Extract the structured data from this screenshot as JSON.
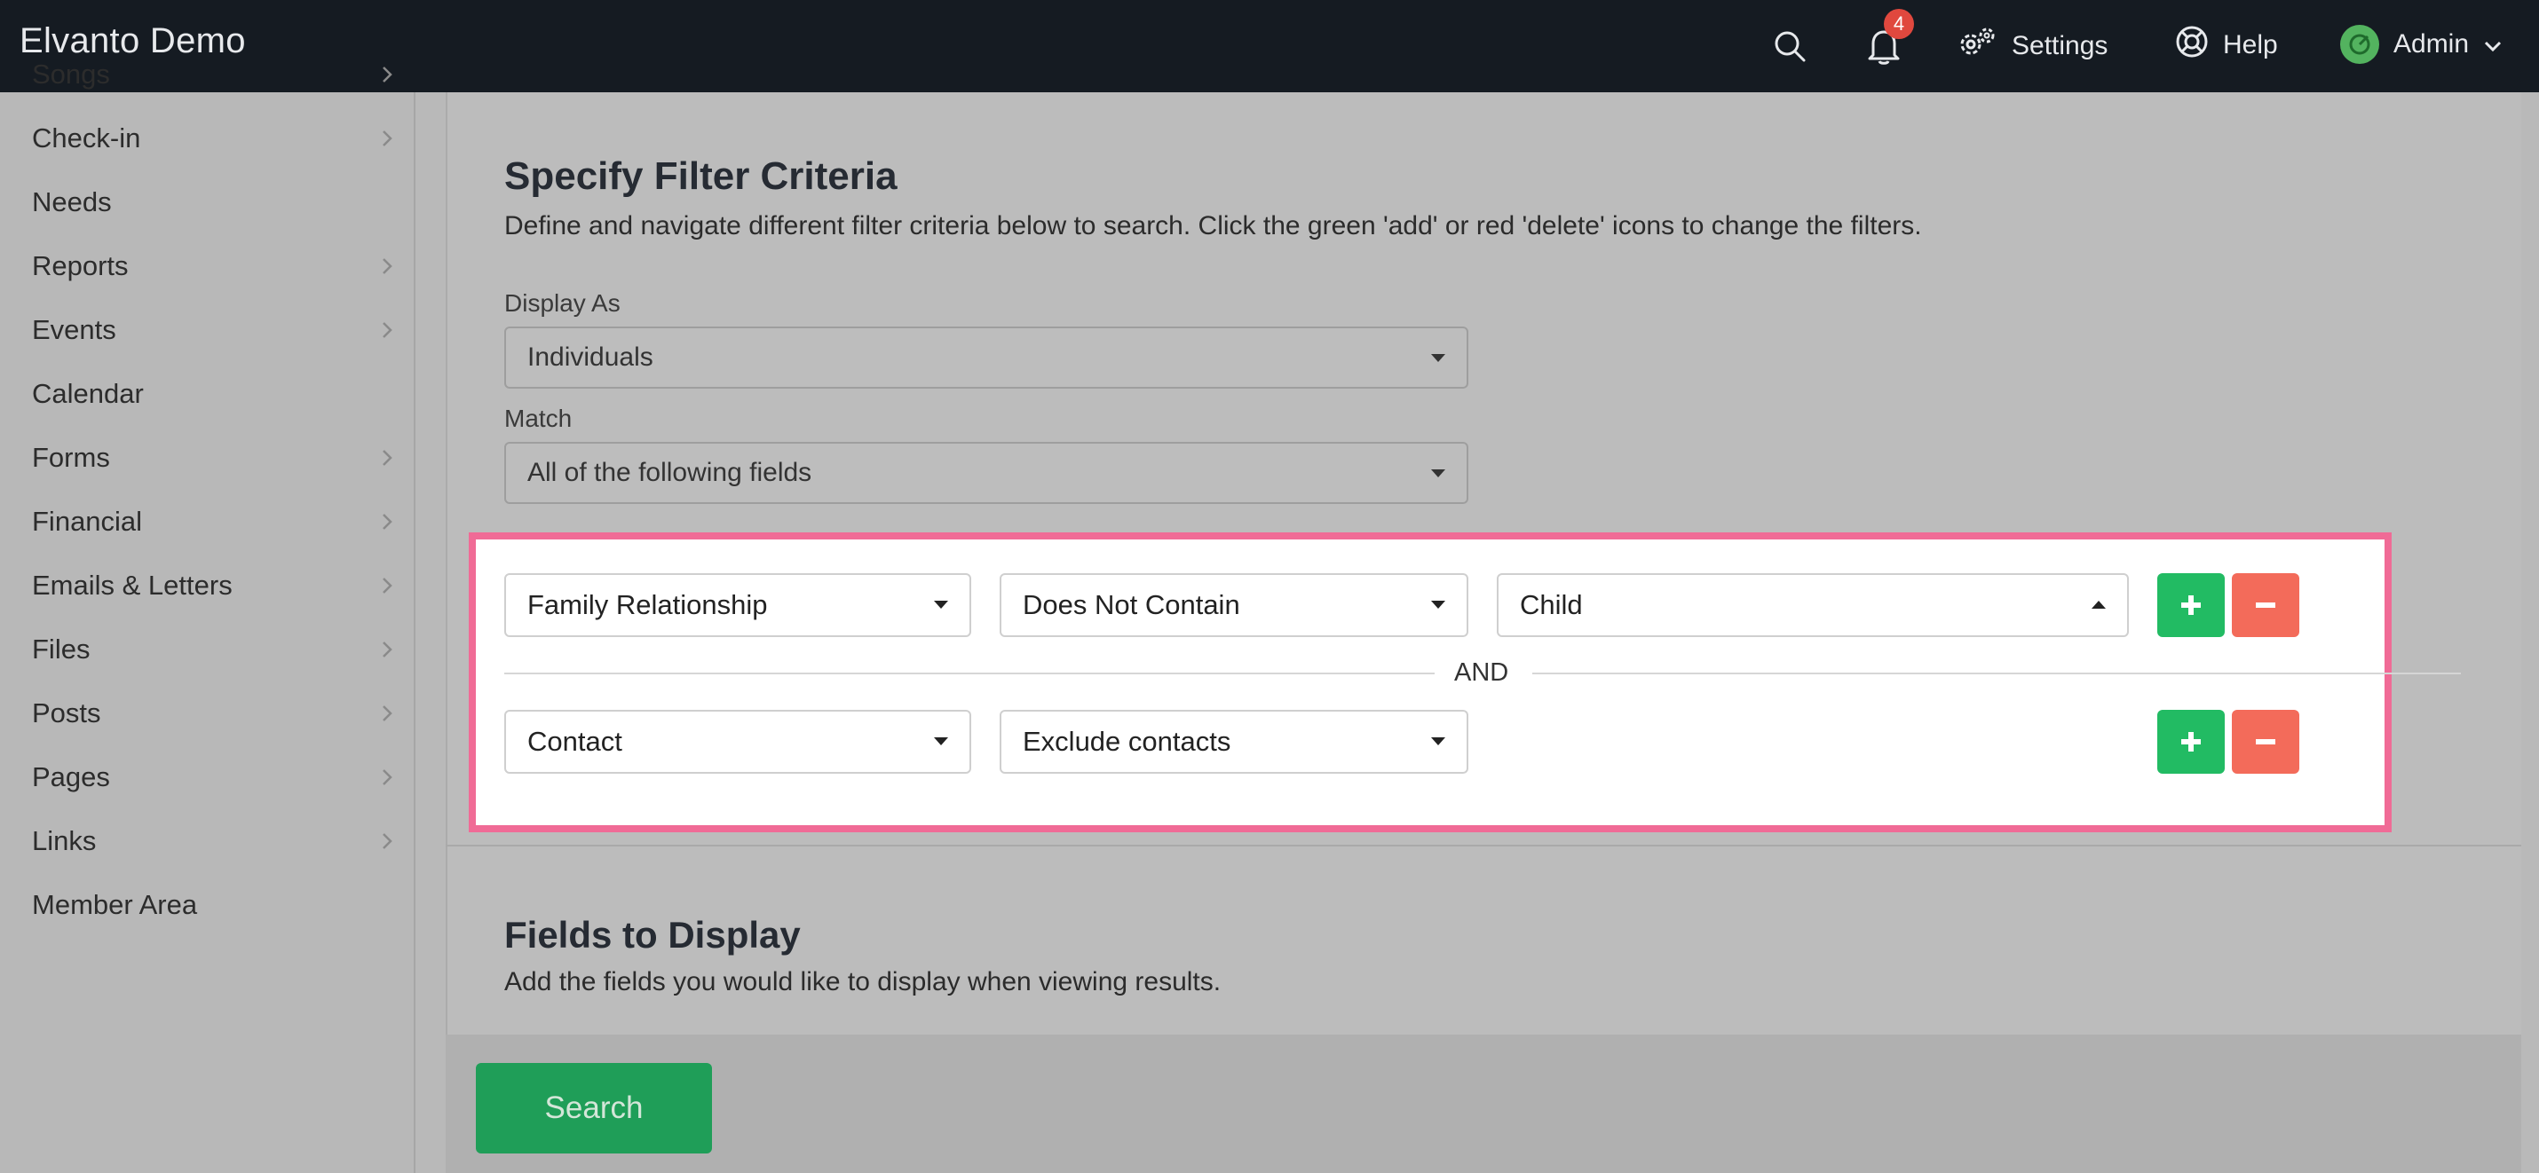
{
  "app": {
    "title": "Elvanto Demo"
  },
  "topbar": {
    "notifications_count": "4",
    "settings_label": "Settings",
    "help_label": "Help",
    "user_label": "Admin"
  },
  "sidebar": {
    "items": [
      {
        "label": "Songs",
        "has_chevron": true
      },
      {
        "label": "Check-in",
        "has_chevron": true
      },
      {
        "label": "Needs",
        "has_chevron": false
      },
      {
        "label": "Reports",
        "has_chevron": true
      },
      {
        "label": "Events",
        "has_chevron": true
      },
      {
        "label": "Calendar",
        "has_chevron": false
      },
      {
        "label": "Forms",
        "has_chevron": true
      },
      {
        "label": "Financial",
        "has_chevron": true
      },
      {
        "label": "Emails & Letters",
        "has_chevron": true
      },
      {
        "label": "Files",
        "has_chevron": true
      },
      {
        "label": "Posts",
        "has_chevron": true
      },
      {
        "label": "Pages",
        "has_chevron": true
      },
      {
        "label": "Links",
        "has_chevron": true
      },
      {
        "label": "Member Area",
        "has_chevron": false
      }
    ]
  },
  "filter": {
    "title": "Specify Filter Criteria",
    "description": "Define and navigate different filter criteria below to search. Click the green 'add' or red 'delete' icons to change the filters.",
    "display_as_label": "Display As",
    "display_as_value": "Individuals",
    "match_label": "Match",
    "match_value": "All of the following fields",
    "rows": [
      {
        "field": "Family Relationship",
        "operator": "Does Not Contain",
        "value": "Child"
      },
      {
        "field": "Contact",
        "operator": "Exclude contacts"
      }
    ],
    "joiner": "AND"
  },
  "fields": {
    "title": "Fields to Display",
    "description": "Add the fields you would like to display when viewing results."
  },
  "actions": {
    "search_label": "Search"
  },
  "colors": {
    "add": "#22bb63",
    "delete": "#f36b5a",
    "highlight": "#f06b96",
    "primary": "#1f9e58"
  }
}
